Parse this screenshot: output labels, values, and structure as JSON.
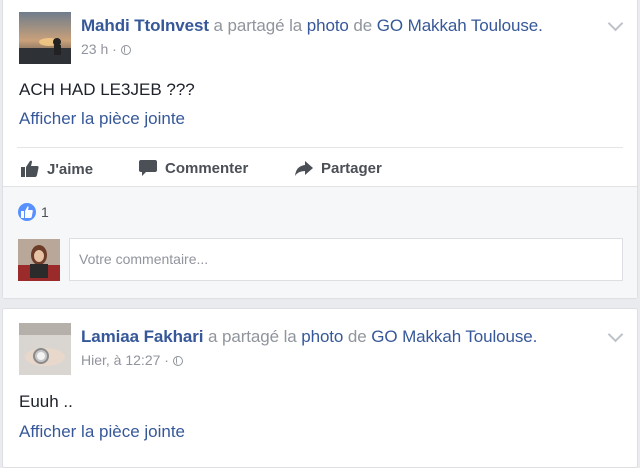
{
  "posts": [
    {
      "author": "Mahdi TtoInvest",
      "shared_text": "a partagé la",
      "photo_word": "photo",
      "de_text": "de",
      "page": "GO Makkah Toulouse.",
      "time": "23 h ·",
      "text": "ACH HAD LE3JEB ???",
      "attachment_link": "Afficher la pièce jointe",
      "actions": {
        "like": "J'aime",
        "comment": "Commenter",
        "share": "Partager"
      },
      "like_count": "1",
      "comment_placeholder": "Votre commentaire..."
    },
    {
      "author": "Lamiaa Fakhari",
      "shared_text": "a partagé la",
      "photo_word": "photo",
      "de_text": "de",
      "page": "GO Makkah Toulouse.",
      "time": "Hier, à 12:27 ·",
      "text": "Euuh ..",
      "attachment_link": "Afficher la pièce jointe"
    }
  ],
  "icons": {
    "like": "thumbs-up-icon",
    "comment": "speech-bubble-icon",
    "share": "share-arrow-icon",
    "privacy": "globe-icon",
    "menu": "chevron-down-icon"
  },
  "colors": {
    "link": "#365899",
    "like_blue": "#5890ff",
    "muted": "#90949c"
  }
}
